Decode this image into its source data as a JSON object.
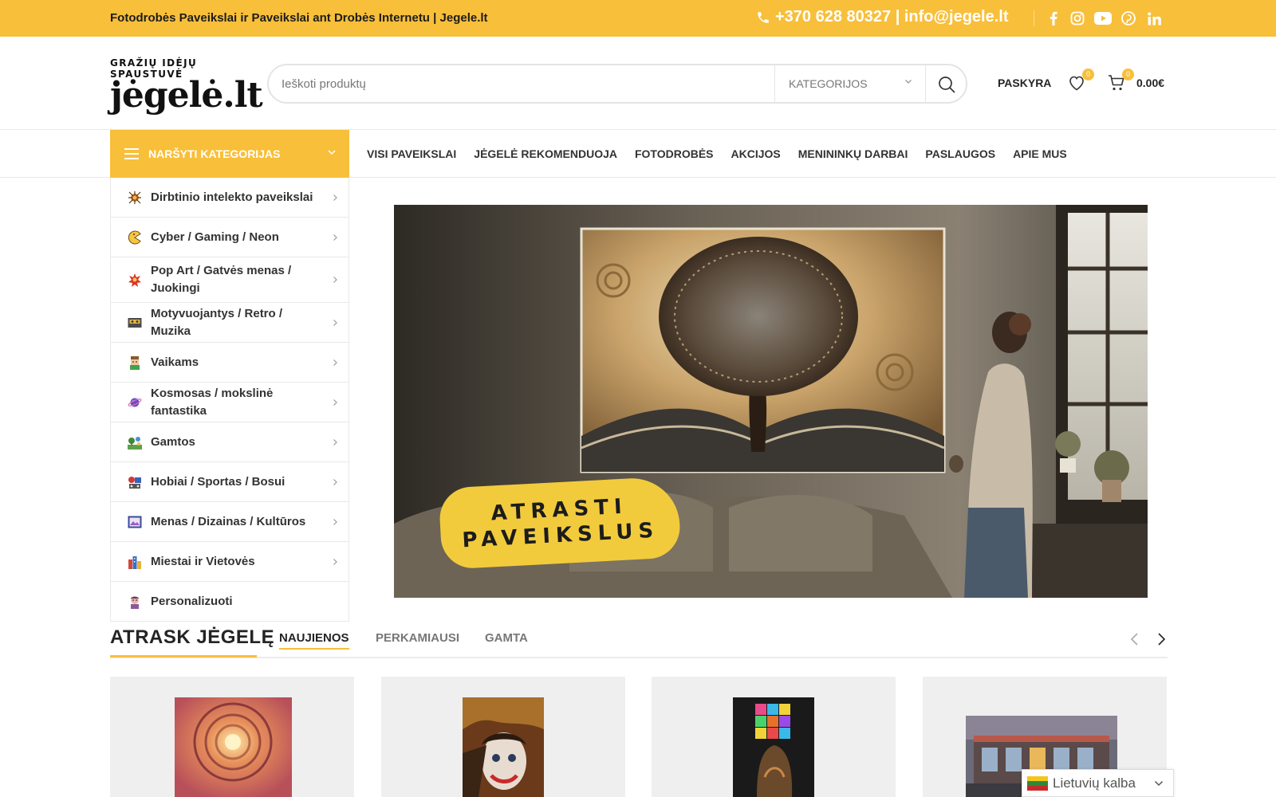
{
  "topbar": {
    "title": "Fotodrobės Paveikslai ir Paveikslai ant Drobės Internetu | Jegele.lt",
    "contact": "+370 628 80327 | info@jegele.lt",
    "social": [
      "facebook-icon",
      "instagram-icon",
      "youtube-icon",
      "pinterest-icon",
      "linkedin-icon"
    ],
    "background": "#f8bf3a"
  },
  "logo": {
    "tagline": "GRAŽIŲ IDĖJŲ SPAUSTUVĖ",
    "name": "jėgelė.lt"
  },
  "search": {
    "placeholder": "Ieškoti produktų",
    "category": "KATEGORIJOS"
  },
  "header": {
    "account": "PASKYRA",
    "wishlist_count": "0",
    "cart_count": "0",
    "cart_total": "0.00€"
  },
  "nav": {
    "browse_label": "NARŠYTI KATEGORIJAS",
    "items": [
      "VISI PAVEIKSLAI",
      "JĖGELĖ REKOMENDUOJA",
      "FOTODROBĖS",
      "AKCIJOS",
      "MENININKŲ DARBAI",
      "PASLAUGOS",
      "APIE MUS"
    ]
  },
  "categories": [
    {
      "label": "Dirbtinio intelekto paveikslai",
      "icon": "ai-brain-icon",
      "has_children": true
    },
    {
      "label": "Cyber / Gaming / Neon",
      "icon": "pacman-icon",
      "has_children": true
    },
    {
      "label": "Pop Art / Gatvės menas / Juokingi",
      "icon": "pop-art-icon",
      "has_children": true
    },
    {
      "label": "Motyvuojantys / Retro / Muzika",
      "icon": "cassette-icon",
      "has_children": true
    },
    {
      "label": "Vaikams",
      "icon": "kid-icon",
      "has_children": true
    },
    {
      "label": "Kosmosas / mokslinė fantastika",
      "icon": "planet-icon",
      "has_children": true
    },
    {
      "label": "Gamtos",
      "icon": "nature-icon",
      "has_children": true
    },
    {
      "label": "Hobiai / Sportas / Bosui",
      "icon": "hobby-icon",
      "has_children": true
    },
    {
      "label": "Menas / Dizainas / Kultūros",
      "icon": "art-frame-icon",
      "has_children": true
    },
    {
      "label": "Miestai ir Vietovės",
      "icon": "city-icon",
      "has_children": true
    },
    {
      "label": "Personalizuoti",
      "icon": "portrait-icon",
      "has_children": false
    }
  ],
  "hero": {
    "cta_line1": "ATRASTI",
    "cta_line2": "PAVEIKSLUS"
  },
  "products_section": {
    "title": "ATRASK JĖGELĘ",
    "tabs": [
      "NAUJIENOS",
      "PERKAMIAUSI",
      "GAMTA"
    ],
    "active_tab": 0
  },
  "products": [
    {
      "image": "spiral-staircase-canvas"
    },
    {
      "image": "joker-portrait-canvas"
    },
    {
      "image": "rubiks-cube-canvas"
    },
    {
      "image": "city-building-canvas"
    }
  ],
  "language": {
    "label": "Lietuvių kalba"
  }
}
